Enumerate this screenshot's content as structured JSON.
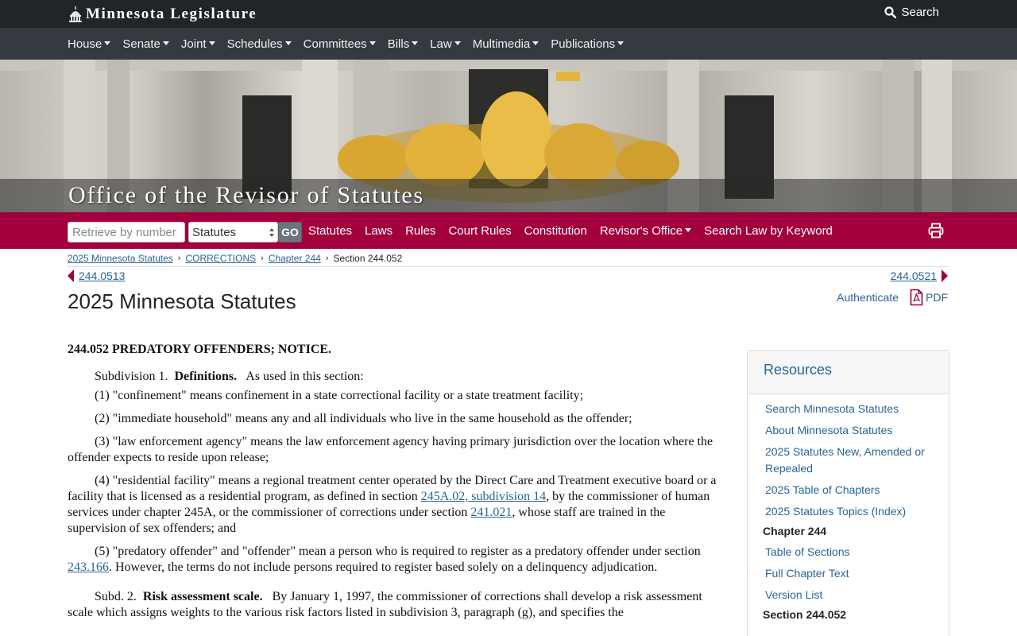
{
  "topbar": {
    "brand": "Minnesota Legislature",
    "search_label": "Search"
  },
  "mainnav": {
    "items": [
      "House",
      "Senate",
      "Joint",
      "Schedules",
      "Committees",
      "Bills",
      "Law",
      "Multimedia",
      "Publications"
    ]
  },
  "hero": {
    "title": "Office of the Revisor of Statutes"
  },
  "revisor_bar": {
    "retrieve_placeholder": "Retrieve by number",
    "type_selected": "Statutes",
    "go_label": "GO",
    "links": [
      "Statutes",
      "Laws",
      "Rules",
      "Court Rules",
      "Constitution",
      "Revisor's Office",
      "Search Law by Keyword"
    ]
  },
  "breadcrumb": {
    "items": [
      "2025 Minnesota Statutes",
      "CORRECTIONS",
      "Chapter 244"
    ],
    "current": "Section 244.052"
  },
  "pager": {
    "prev": "244.0513",
    "next": "244.0521"
  },
  "page": {
    "title": "2025 Minnesota Statutes",
    "authenticate": "Authenticate",
    "pdf": "PDF"
  },
  "statute": {
    "heading": "244.052 PREDATORY OFFENDERS; NOTICE.",
    "subd1_label": "Subdivision 1.",
    "subd1_title": "Definitions.",
    "subd1_intro": "As used in this section:",
    "def1": "(1) \"confinement\" means confinement in a state correctional facility or a state treatment facility;",
    "def2": "(2) \"immediate household\" means any and all individuals who live in the same household as the offender;",
    "def3": "(3) \"law enforcement agency\" means the law enforcement agency having primary jurisdiction over the location where the offender expects to reside upon release;",
    "def4_a": "(4) \"residential facility\" means a regional treatment center operated by the Direct Care and Treatment executive board or a facility that is licensed as a residential program, as defined in section ",
    "def4_link1": "245A.02, subdivision 14",
    "def4_b": ", by the commissioner of human services under chapter 245A, or the commissioner of corrections under section ",
    "def4_link2": "241.021",
    "def4_c": ", whose staff are trained in the supervision of sex offenders; and",
    "def5_a": "(5) \"predatory offender\" and \"offender\" mean a person who is required to register as a predatory offender under section ",
    "def5_link": "243.166",
    "def5_b": ". However, the terms do not include persons required to register based solely on a delinquency adjudication.",
    "subd2_label": "Subd. 2.",
    "subd2_title": "Risk assessment scale.",
    "subd2_text": "By January 1, 1997, the commissioner of corrections shall develop a risk assessment scale which assigns weights to the various risk factors listed in subdivision 3, paragraph (g), and specifies the"
  },
  "resources": {
    "title": "Resources",
    "links": [
      "Search Minnesota Statutes",
      "About Minnesota Statutes",
      "2025 Statutes New, Amended or Repealed",
      "2025 Table of Chapters",
      "2025 Statutes Topics (Index)"
    ],
    "chapter_heading": "Chapter 244",
    "chapter_links": [
      "Table of Sections",
      "Full Chapter Text",
      "Version List"
    ],
    "section_heading": "Section 244.052"
  },
  "colors": {
    "accent": "#a2003c",
    "link": "#2a6496",
    "topbar": "#212529",
    "nav": "#343a40"
  },
  "icons": [
    "capitol-icon",
    "search-icon",
    "chevron-down-icon",
    "print-icon",
    "pdf-icon",
    "prev-arrow-icon",
    "next-arrow-icon"
  ]
}
